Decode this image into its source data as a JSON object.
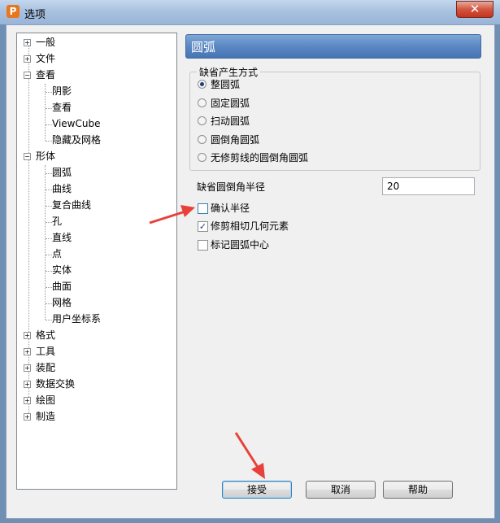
{
  "window": {
    "title": "选项",
    "app_icon_letter": "P",
    "close_symbol": "✕"
  },
  "tree": {
    "items": [
      {
        "label": "一般",
        "expander": "+"
      },
      {
        "label": "文件",
        "expander": "+"
      },
      {
        "label": "查看",
        "expander": "−"
      },
      {
        "label": "阴影"
      },
      {
        "label": "查看"
      },
      {
        "label": "ViewCube"
      },
      {
        "label": "隐藏及网格"
      },
      {
        "label": "形体",
        "expander": "−"
      },
      {
        "label": "圆弧"
      },
      {
        "label": "曲线"
      },
      {
        "label": "复合曲线"
      },
      {
        "label": "孔"
      },
      {
        "label": "直线"
      },
      {
        "label": "点"
      },
      {
        "label": "实体"
      },
      {
        "label": "曲面"
      },
      {
        "label": "网格"
      },
      {
        "label": "用户坐标系"
      },
      {
        "label": "格式",
        "expander": "+"
      },
      {
        "label": "工具",
        "expander": "+"
      },
      {
        "label": "装配",
        "expander": "+"
      },
      {
        "label": "数据交换",
        "expander": "+"
      },
      {
        "label": "绘图",
        "expander": "+"
      },
      {
        "label": "制造",
        "expander": "+"
      }
    ]
  },
  "panel": {
    "title": "圆弧",
    "group_title": "缺省产生方式",
    "radios": [
      {
        "label": "整圆弧",
        "checked": true
      },
      {
        "label": "固定圆弧",
        "checked": false
      },
      {
        "label": "扫动圆弧",
        "checked": false
      },
      {
        "label": "圆倒角圆弧",
        "checked": false
      },
      {
        "label": "无修剪线的圆倒角圆弧",
        "checked": false
      }
    ],
    "radius_label": "缺省圆倒角半径",
    "radius_value": "20",
    "checkboxes": [
      {
        "label": "确认半径",
        "checked": false
      },
      {
        "label": "修剪相切几何元素",
        "checked": true
      },
      {
        "label": "标记圆弧中心",
        "checked": false
      }
    ],
    "check_mark": "✓"
  },
  "buttons": {
    "ok": "接受",
    "cancel": "取消",
    "help": "帮助"
  },
  "colors": {
    "header_blue": "#5b88c3",
    "annotation_red": "#e8413a",
    "close_red": "#c4331c"
  }
}
